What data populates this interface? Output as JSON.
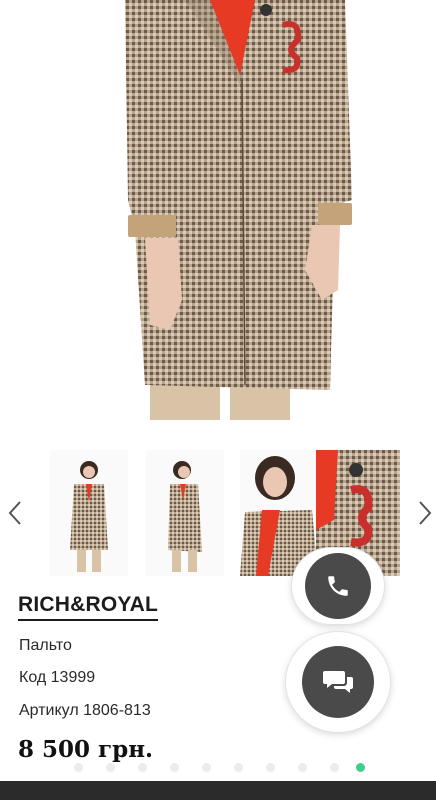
{
  "product": {
    "brand": "RICH&ROYAL",
    "name": "Пальто",
    "code": "Код 13999",
    "article": "Артикул 1806-813",
    "price": "8 500 грн."
  },
  "gallery": {
    "thumbnails": [
      "front-full",
      "side-full",
      "closeup-face",
      "detail-brooch"
    ],
    "active_dot": 9,
    "dot_count": 10
  },
  "colors": {
    "coat": "#9b8670",
    "scarf": "#e63a24",
    "accent_dot": "#3fd088",
    "fab": "#4a4a4a"
  },
  "icons": [
    "chevron-left-icon",
    "chevron-right-icon",
    "phone-icon",
    "chat-icon"
  ]
}
